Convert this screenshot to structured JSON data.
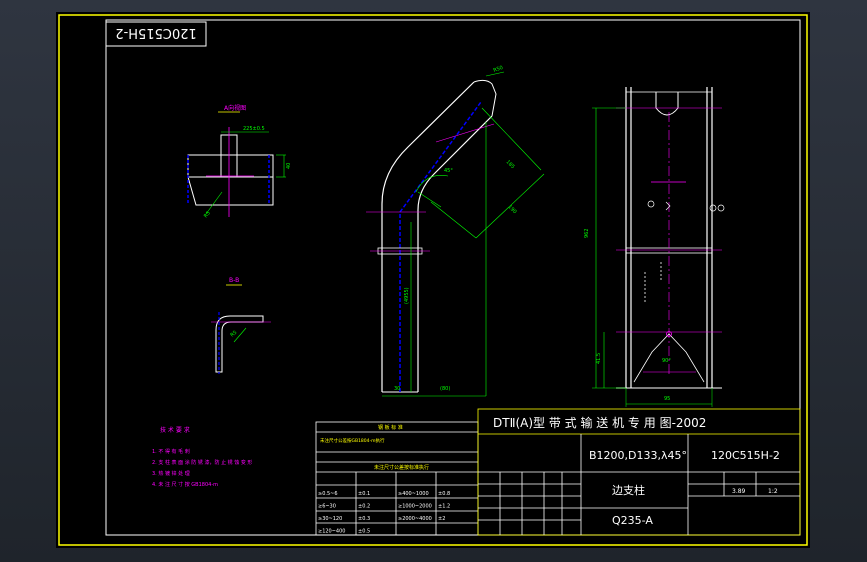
{
  "drawing_no_flipped": "120C515H-2",
  "views": {
    "section_a": "A向视图",
    "section_b": "B-B",
    "dim_a_width": "225±0.5",
    "dim_a_height": "40",
    "dim_a_r": "R5",
    "dim_b_r": "R5",
    "dim_bend_r": "R50",
    "dim_angle": "45°",
    "dim_len1": "(4955)",
    "dim_len2": "(80)",
    "dim_len3": "30",
    "dim_diag1": "185",
    "dim_diag2": "190",
    "dim_right_h": "962",
    "dim_right_w": "95",
    "dim_right_b": "41.5",
    "dim_right_angle": "90°"
  },
  "tech_req": {
    "title": "技 术 要 求",
    "items": [
      "1. 不 得 有 毛 刺",
      "2. 支 柱 表 面 涂 防 锈 漆，防 止 锈 蚀 变 形",
      "3. 热 镀 锌 处 理",
      "4. 未 注 尺 寸 按 GB1804-m"
    ]
  },
  "tolerance_table": {
    "title1": "钢 板 标 准",
    "title2": "未注尺寸公差按标准执行",
    "rows": [
      [
        "≥0.5~6",
        "±0.1",
        "≥400~1000",
        "±0.8"
      ],
      [
        "≥6~30",
        "±0.2",
        "≥1000~2000",
        "±1.2"
      ],
      [
        "≥30~120",
        "±0.3",
        "≥2000~4000",
        "±2"
      ],
      [
        "≥120~400",
        "±0.5",
        "",
        ""
      ]
    ]
  },
  "title_block": {
    "series_title": "DTⅡ(A)型  带 式 输 送 机 专 用 图-2002",
    "spec": "B1200,D133,λ45°",
    "drawing_no": "120C515H-2",
    "part_name": "边支柱",
    "material": "Q235-A",
    "weight": "3.89",
    "scale": "1:2"
  }
}
